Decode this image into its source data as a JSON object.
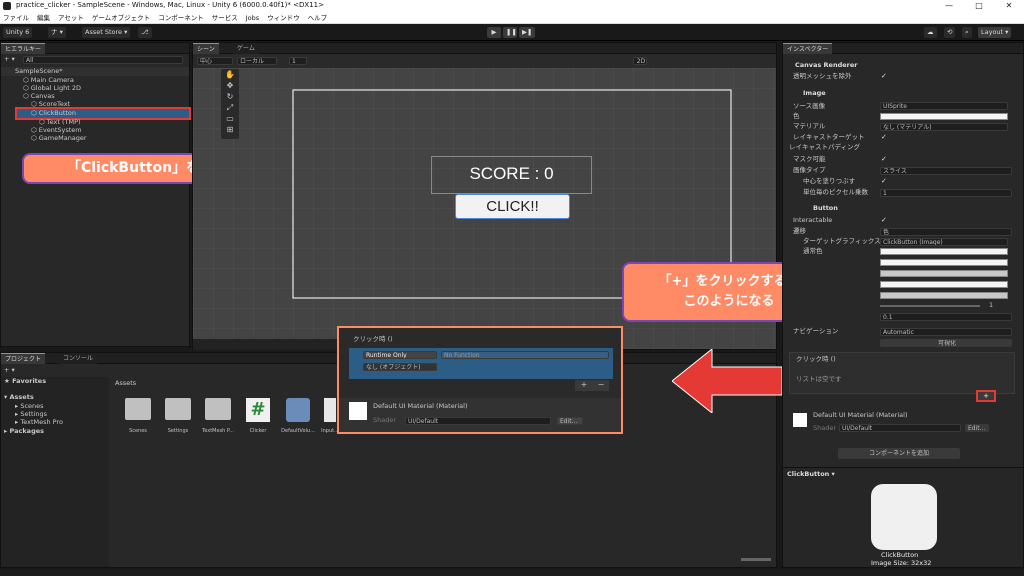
{
  "window": {
    "title": "practice_clicker - SampleScene - Windows, Mac, Linux - Unity 6 (6000.0.40f1)* <DX11>",
    "min": "—",
    "max": "□",
    "close": "✕"
  },
  "menu": [
    "ファイル",
    "編集",
    "アセット",
    "ゲームオブジェクト",
    "コンポーネント",
    "サービス",
    "Jobs",
    "ウィンドウ",
    "ヘルプ"
  ],
  "toolbar": {
    "unity": "Unity 6",
    "account": "ナ ▾",
    "asset_store": "Asset Store ▾",
    "layout": "Layout ▾",
    "play_icon": "▶",
    "pause_icon": "❚❚",
    "step_icon": "▶❚"
  },
  "hierarchy": {
    "tab": "ヒエラルキー",
    "search_placeholder": "All",
    "scene": "SampleScene*",
    "items": [
      "Main Camera",
      "Global Light 2D",
      "Canvas",
      "ScoreText",
      "ClickButton",
      "Text (TMP)",
      "EventSystem",
      "GameManager"
    ]
  },
  "scene": {
    "tab_scene": "シーン",
    "tab_game": "ゲーム",
    "pivot": "中心",
    "local": "ローカル",
    "grid": "1",
    "mode2d": "2D",
    "score_text": "SCORE : 0",
    "button_text": "CLICK!!"
  },
  "callouts": {
    "select": "「ClickButton」を選択",
    "plus_line1": "「+」をクリックすると",
    "plus_line2": "このようになる"
  },
  "zoom_popup": {
    "event": "クリック時 ()",
    "runtime": "Runtime Only",
    "function": "No Function",
    "object": "なし (オブジェクト)",
    "plus": "+",
    "minus": "−",
    "material": "Default UI Material (Material)",
    "shader_label": "Shader",
    "shader": "UI/Default",
    "edit": "Edit..."
  },
  "project": {
    "tab_project": "プロジェクト",
    "tab_console": "コンソール",
    "favorites": "Favorites",
    "assets": "Assets",
    "tree": [
      "Scenes",
      "Settings",
      "TextMesh Pro"
    ],
    "packages": "Packages",
    "breadcrumb": "Assets",
    "files": [
      "Scenes",
      "Settings",
      "TextMesh P...",
      "Clicker",
      "DefaultVolu...",
      "Input..."
    ]
  },
  "inspector": {
    "tab": "インスペクター",
    "canvas_renderer": "Canvas Renderer",
    "cull_transparent": "透明メッシュを除外",
    "image": "Image",
    "source_image_label": "ソース画像",
    "source_image": "UISprite",
    "color_label": "色",
    "material_label": "マテリアル",
    "material": "なし (マテリアル)",
    "raycast_target": "レイキャストターゲット",
    "raycast_padding": "レイキャストパディング",
    "maskable": "マスク可能",
    "image_type_label": "画像タイプ",
    "image_type": "スライス",
    "fill_center": "中心を塗りつぶす",
    "pixels_per_unit_label": "単位毎のピクセル乗数",
    "pixels_per_unit": "1",
    "button": "Button",
    "interactable": "Interactable",
    "transition_label": "遷移",
    "transition": "色",
    "target_graphic_label": "ターゲットグラフィックス",
    "target_graphic": "ClickButton (Image)",
    "normal_color": "通常色",
    "color_multiplier": "1",
    "fade_duration": "0.1",
    "navigation_label": "ナビゲーション",
    "navigation": "Automatic",
    "visualize": "可視化",
    "onclick": "クリック時 ()",
    "list_empty": "リストは空です",
    "plus": "+",
    "material_asset": "Default UI Material (Material)",
    "shader_label": "Shader",
    "shader": "UI/Default",
    "edit": "Edit...",
    "add_component": "コンポーネントを追加",
    "preview_title": "ClickButton ▾",
    "preview_name": "ClickButton",
    "preview_size": "Image Size: 32x32"
  },
  "colors": {
    "accent_red": "#e53935",
    "callout": "#ff8a66",
    "callout_border": "#7a45b5",
    "selection": "#2c5d87"
  }
}
